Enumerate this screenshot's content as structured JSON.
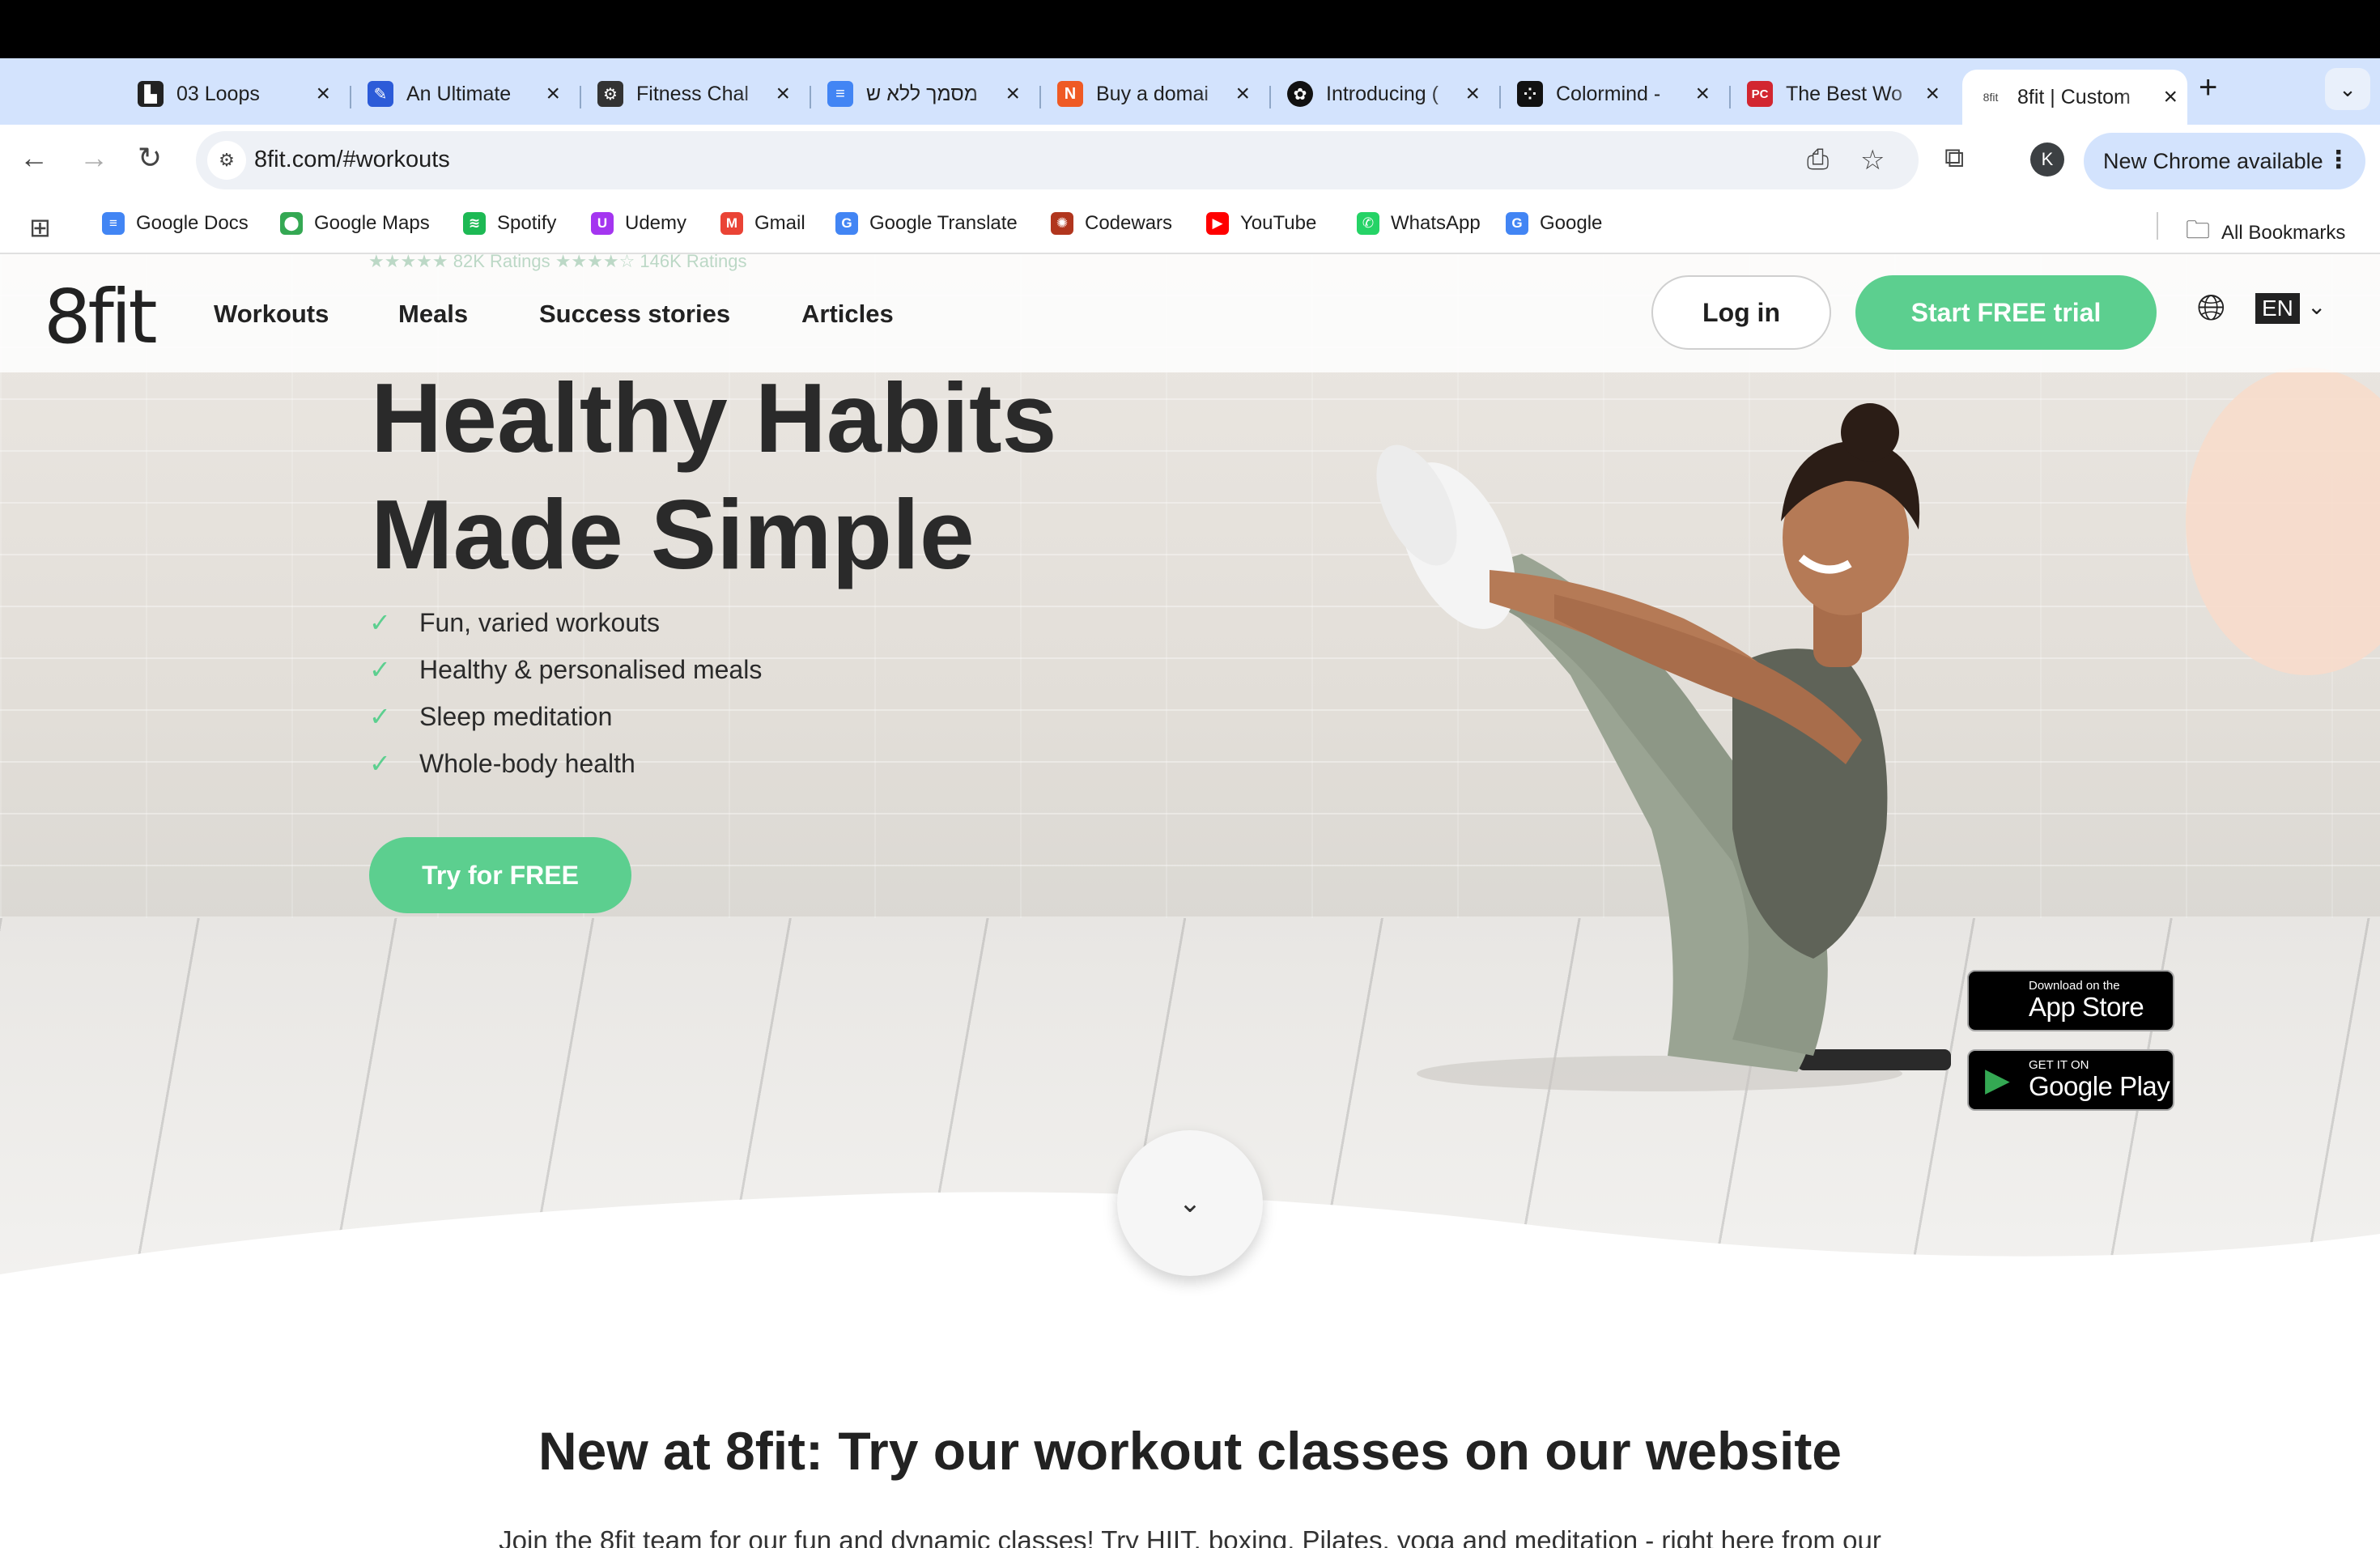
{
  "browser": {
    "tabs": [
      {
        "title": "03 Loops",
        "favicon": "loops-icon",
        "color": "#222222",
        "letter": "▙"
      },
      {
        "title": "An Ultimate",
        "favicon": "ultimate-icon",
        "color": "#2c5bd8",
        "letter": "✎"
      },
      {
        "title": "Fitness Chal",
        "favicon": "fitness-icon",
        "color": "#333333",
        "letter": "⚙"
      },
      {
        "title": "מסמך ללא ש",
        "favicon": "docs-icon",
        "color": "#4285f4",
        "letter": "≡"
      },
      {
        "title": "Buy a domai",
        "favicon": "domain-icon",
        "color": "#ef5a24",
        "letter": "N"
      },
      {
        "title": "Introducing (",
        "favicon": "openai-icon",
        "color": "#111111",
        "letter": "✿"
      },
      {
        "title": "Colormind -",
        "favicon": "colormind-icon",
        "color": "#111111",
        "letter": "⁘"
      },
      {
        "title": "The Best Wo",
        "favicon": "pc-icon",
        "color": "#d22630",
        "letter": "PC"
      },
      {
        "title": "8fit | Custom",
        "favicon": "8fit-icon",
        "color": "#ffffff",
        "letter": "8fit",
        "active": true
      }
    ],
    "url": "8fit.com/#workouts",
    "update_label": "New Chrome available",
    "profile_initial": "K",
    "bookmarks": [
      {
        "label": "Google Docs",
        "color": "#4285f4",
        "glyph": "≡"
      },
      {
        "label": "Google Maps",
        "color": "#34a853",
        "glyph": "⬤"
      },
      {
        "label": "Spotify",
        "color": "#1db954",
        "glyph": "≋"
      },
      {
        "label": "Udemy",
        "color": "#a435f0",
        "glyph": "U"
      },
      {
        "label": "Gmail",
        "color": "#ea4335",
        "glyph": "M"
      },
      {
        "label": "Google Translate",
        "color": "#4285f4",
        "glyph": "G"
      },
      {
        "label": "Codewars",
        "color": "#b1361e",
        "glyph": "✺"
      },
      {
        "label": "YouTube",
        "color": "#ff0000",
        "glyph": "▶"
      },
      {
        "label": "WhatsApp",
        "color": "#25d366",
        "glyph": "✆"
      },
      {
        "label": "Google",
        "color": "#4285f4",
        "glyph": "G"
      }
    ],
    "all_bookmarks_label": "All Bookmarks"
  },
  "site": {
    "logo": "8fit",
    "nav": [
      "Workouts",
      "Meals",
      "Success stories",
      "Articles"
    ],
    "ratings_text": "★★★★★ 82K Ratings        ★★★★☆ 146K Ratings",
    "login_label": "Log in",
    "trial_label": "Start FREE trial",
    "lang": "EN",
    "hero": {
      "title_line1": "Healthy Habits",
      "title_line2": "Made Simple",
      "features": [
        "Fun, varied workouts",
        "Healthy & personalised meals",
        "Sleep meditation",
        "Whole-body health"
      ],
      "cta": "Try for FREE"
    },
    "stores": {
      "apple_small": "Download on the",
      "apple_big": "App Store",
      "google_small": "GET IT ON",
      "google_big": "Google Play"
    },
    "section_title": "New at 8fit: Try our workout classes on our website",
    "section_text": "Join the 8fit team for our fun and dynamic classes! Try HIIT, boxing, Pilates, yoga and meditation - right here from our"
  },
  "colors": {
    "accent_green": "#5ccf8f",
    "tabstrip": "#d3e3fd"
  }
}
